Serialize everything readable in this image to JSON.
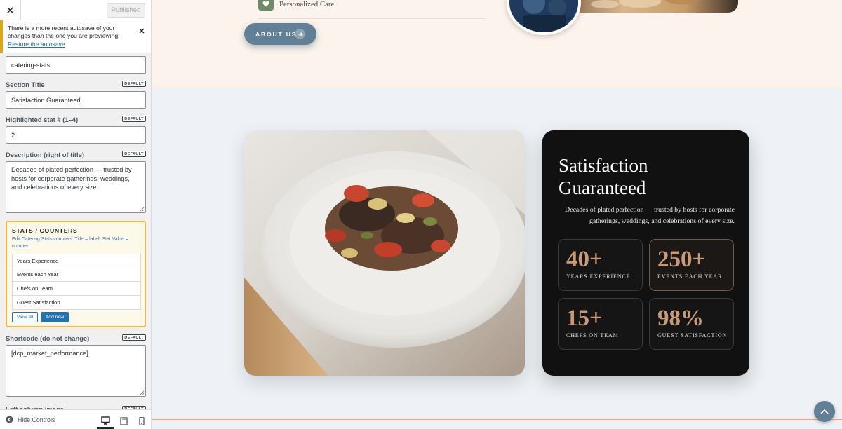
{
  "customizer": {
    "published_label": "Published",
    "notice": {
      "text": "There is a more recent autosave of your changes than the one you are previewing.",
      "link": "Restore the autosave"
    },
    "slug_value": "catering-stats",
    "default_label": "DEFAULT",
    "section_title": {
      "label": "Section Title",
      "value": "Satisfaction Guaranteed"
    },
    "highlighted_stat": {
      "label": "Highlighted stat # (1–4)",
      "value": "2"
    },
    "description": {
      "label": "Description (right of title)",
      "value": "Decades of plated perfection — trusted by hosts for corporate gatherings, weddings, and celebrations of every size."
    },
    "stats_counters": {
      "title": "STATS / COUNTERS",
      "description": "Edit Catering Stats counters. Title = label, Stat Value = number.",
      "items": [
        "Years Experience",
        "Events each Year",
        "Chefs on Team",
        "Guest Satisfaction"
      ],
      "view_all": "View all",
      "add_new": "Add new"
    },
    "shortcode": {
      "label": "Shortcode (do not change)",
      "value": "[dcp_market_performance]"
    },
    "left_image_label": "Left column image",
    "hide_controls": "Hide Controls"
  },
  "preview": {
    "personalized_care": "Personalized Care",
    "about_button": "ABOUT US",
    "card": {
      "title": "Satisfaction Guaranteed",
      "description": "Decades of plated perfection — trusted by hosts for corporate gatherings, weddings, and celebrations of every size.",
      "stats": [
        {
          "value": "40+",
          "label": "YEARS EXPERIENCE"
        },
        {
          "value": "250+",
          "label": "EVENTS EACH YEAR"
        },
        {
          "value": "15+",
          "label": "CHEFS ON TEAM"
        },
        {
          "value": "98%",
          "label": "GUEST SATISFACTION"
        }
      ]
    }
  },
  "colors": {
    "accent_blue": "#2271b1",
    "notice_border": "#dba617",
    "stats_box_border": "#f0b849",
    "about_button": "#617f95",
    "stat_value": "#c89a78",
    "dark_card": "#111111",
    "divider_orange": "#e8a37a"
  }
}
